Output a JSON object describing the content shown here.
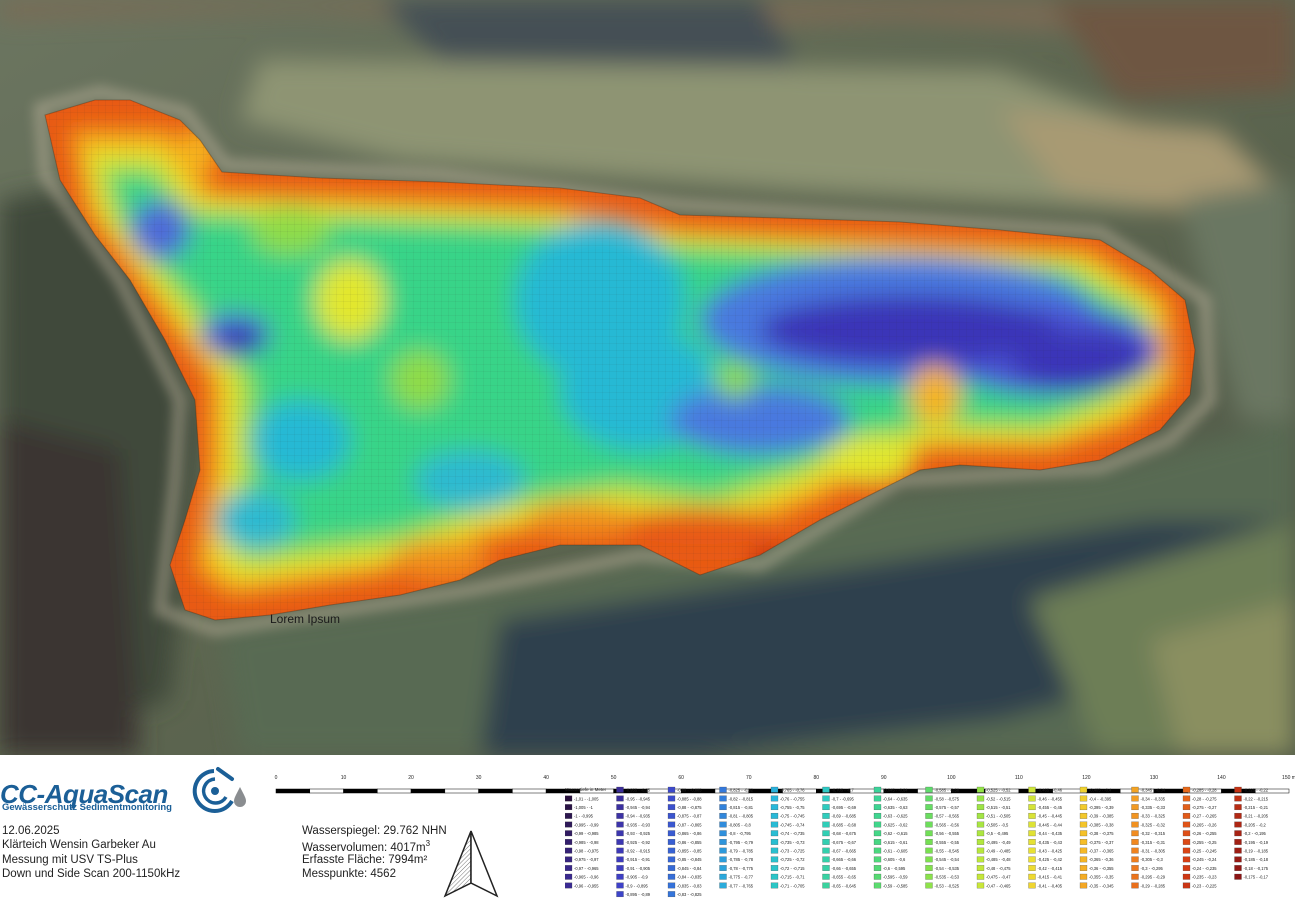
{
  "logo": {
    "name": "CC-AquaScan",
    "tagline": "Gewässerschutz Sedimentmonitoring"
  },
  "survey": {
    "date": "12.06.2025",
    "location": "Klärteich Wensin Garbeker Au",
    "method": "Messung mit USV TS-Plus",
    "scan": "Down und Side Scan 200-1150kHz"
  },
  "stats": {
    "water_level": "Wasserspiegel: 29.762 NHN",
    "volume_label": "Wasservolumen: 4017m",
    "volume_sup": "3",
    "area": "Erfasste Fläche: 7994m²",
    "points": "Messpunkte: 4562"
  },
  "map_label": "Lorem Ipsum",
  "scale": {
    "unit": "m",
    "max": 150,
    "ticks": [
      "0",
      "10",
      "20",
      "30",
      "40",
      "50",
      "60",
      "70",
      "80",
      "90",
      "100",
      "110",
      "120",
      "130",
      "140",
      "150 m"
    ]
  },
  "legend": {
    "title": "Wassertiefe in Meter",
    "depth_min": -1.01,
    "depth_max": -0.15,
    "columns": [
      [
        "-1,01 - -1,005",
        "-1,005 - -1",
        "-1 - -0,995",
        "-0,995 - -0,99",
        "-0,99 - -0,985",
        "-0,985 - -0,98",
        "-0,98 - -0,975",
        "-0,975 - -0,97",
        "-0,97 - -0,965",
        "-0,965 - -0,96",
        "-0,96 - -0,955"
      ],
      [
        "-0,955 - -0,95",
        "-0,95 - -0,945",
        "-0,945 - -0,94",
        "-0,94 - -0,935",
        "-0,935 - -0,93",
        "-0,93 - -0,925",
        "-0,925 - -0,92",
        "-0,92 - -0,915",
        "-0,915 - -0,91",
        "-0,91 - -0,905",
        "-0,905 - -0,9",
        "-0,9 - -0,895",
        "-0,895 - -0,89"
      ],
      [
        "-0,89 - -0,885",
        "-0,885 - -0,88",
        "-0,88 - -0,875",
        "-0,875 - -0,87",
        "-0,87 - -0,865",
        "-0,865 - -0,86",
        "-0,86 - -0,855",
        "-0,855 - -0,85",
        "-0,85 - -0,845",
        "-0,845 - -0,84",
        "-0,84 - -0,835",
        "-0,835 - -0,83",
        "-0,83 - -0,825"
      ],
      [
        "-0,825 - -0,82",
        "-0,82 - -0,815",
        "-0,815 - -0,81",
        "-0,81 - -0,805",
        "-0,805 - -0,8",
        "-0,8 - -0,795",
        "-0,795 - -0,79",
        "-0,79 - -0,785",
        "-0,785 - -0,78",
        "-0,78 - -0,775",
        "-0,775 - -0,77",
        "-0,77 - -0,765"
      ],
      [
        "-0,765 - -0,76",
        "-0,76 - -0,755",
        "-0,755 - -0,75",
        "-0,75 - -0,745",
        "-0,745 - -0,74",
        "-0,74 - -0,735",
        "-0,735 - -0,73",
        "-0,73 - -0,725",
        "-0,725 - -0,72",
        "-0,72 - -0,715",
        "-0,715 - -0,71",
        "-0,71 - -0,705"
      ],
      [
        "-0,705 - -0,7",
        "-0,7 - -0,695",
        "-0,695 - -0,69",
        "-0,69 - -0,685",
        "-0,685 - -0,68",
        "-0,68 - -0,675",
        "-0,675 - -0,67",
        "-0,67 - -0,665",
        "-0,665 - -0,66",
        "-0,66 - -0,655",
        "-0,655 - -0,65",
        "-0,65 - -0,645"
      ],
      [
        "-0,645 - -0,64",
        "-0,64 - -0,635",
        "-0,635 - -0,63",
        "-0,63 - -0,625",
        "-0,625 - -0,62",
        "-0,62 - -0,615",
        "-0,615 - -0,61",
        "-0,61 - -0,605",
        "-0,605 - -0,6",
        "-0,6 - -0,595",
        "-0,595 - -0,59",
        "-0,59 - -0,585"
      ],
      [
        "-0,585 - -0,58",
        "-0,58 - -0,575",
        "-0,575 - -0,57",
        "-0,57 - -0,565",
        "-0,565 - -0,56",
        "-0,56 - -0,555",
        "-0,555 - -0,55",
        "-0,55 - -0,545",
        "-0,545 - -0,54",
        "-0,54 - -0,535",
        "-0,535 - -0,53",
        "-0,53 - -0,525"
      ],
      [
        "-0,525 - -0,52",
        "-0,52 - -0,515",
        "-0,515 - -0,51",
        "-0,51 - -0,505",
        "-0,505 - -0,5",
        "-0,5 - -0,495",
        "-0,495 - -0,49",
        "-0,49 - -0,485",
        "-0,485 - -0,48",
        "-0,48 - -0,475",
        "-0,475 - -0,47",
        "-0,47 - -0,465"
      ],
      [
        "-0,465 - -0,46",
        "-0,46 - -0,455",
        "-0,455 - -0,45",
        "-0,45 - -0,445",
        "-0,445 - -0,44",
        "-0,44 - -0,435",
        "-0,435 - -0,43",
        "-0,43 - -0,425",
        "-0,425 - -0,42",
        "-0,42 - -0,415",
        "-0,415 - -0,41",
        "-0,41 - -0,405"
      ],
      [
        "-0,405 - -0,4",
        "-0,4 - -0,395",
        "-0,395 - -0,39",
        "-0,39 - -0,385",
        "-0,385 - -0,38",
        "-0,38 - -0,375",
        "-0,375 - -0,37",
        "-0,37 - -0,365",
        "-0,365 - -0,36",
        "-0,36 - -0,355",
        "-0,355 - -0,35",
        "-0,35 - -0,345"
      ],
      [
        "-0,345 - -0,34",
        "-0,34 - -0,335",
        "-0,335 - -0,33",
        "-0,33 - -0,325",
        "-0,325 - -0,32",
        "-0,32 - -0,315",
        "-0,315 - -0,31",
        "-0,31 - -0,305",
        "-0,305 - -0,3",
        "-0,3 - -0,295",
        "-0,295 - -0,29",
        "-0,29 - -0,285"
      ],
      [
        "-0,285 - -0,28",
        "-0,28 - -0,275",
        "-0,275 - -0,27",
        "-0,27 - -0,265",
        "-0,265 - -0,26",
        "-0,26 - -0,255",
        "-0,255 - -0,25",
        "-0,25 - -0,245",
        "-0,245 - -0,24",
        "-0,24 - -0,235",
        "-0,235 - -0,23",
        "-0,23 - -0,225"
      ],
      [
        "-0,225 - -0,22",
        "-0,22 - -0,215",
        "-0,215 - -0,21",
        "-0,21 - -0,205",
        "-0,205 - -0,2",
        "-0,2 - -0,195",
        "-0,195 - -0,19",
        "-0,19 - -0,185",
        "-0,185 - -0,18",
        "-0,18 - -0,175",
        "-0,175 - -0,17"
      ]
    ]
  },
  "colors": {
    "brand": "#1b5f97",
    "deep": "#2b1a9a",
    "shallow": "#c31c0e"
  },
  "icons": [
    "aquascan-logo-icon",
    "north-arrow-icon"
  ]
}
